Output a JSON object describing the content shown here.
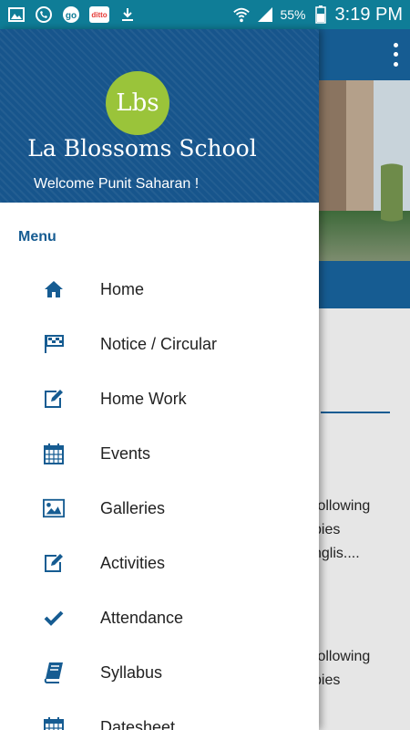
{
  "status_bar": {
    "battery": "55%",
    "time": "3:19 PM",
    "notification_icons": [
      "image-icon",
      "phone-icon",
      "go-icon",
      "ditto-icon",
      "download-icon"
    ],
    "ditto_text": "ditto"
  },
  "drawer": {
    "logo_text": "Lbs",
    "school_name": "La Blossoms School",
    "welcome": "Welcome Punit Saharan !",
    "menu_title": "Menu",
    "items": [
      {
        "label": "Home",
        "icon": "home-icon"
      },
      {
        "label": "Notice / Circular",
        "icon": "flag-icon"
      },
      {
        "label": "Home Work",
        "icon": "edit-icon"
      },
      {
        "label": "Events",
        "icon": "calendar-icon"
      },
      {
        "label": "Galleries",
        "icon": "image-icon"
      },
      {
        "label": "Activities",
        "icon": "edit-icon"
      },
      {
        "label": "Attendance",
        "icon": "check-icon"
      },
      {
        "label": "Syllabus",
        "icon": "book-icon"
      },
      {
        "label": "Datesheet",
        "icon": "calendar-icon"
      }
    ]
  },
  "background": {
    "line1a": "following",
    "line1b": "pies",
    "line1c": "nglis....",
    "line2a": "following",
    "line2b": "pies"
  },
  "colors": {
    "primary": "#165c92",
    "status_bar": "#0f7d97",
    "logo_green": "#9ac43a"
  }
}
